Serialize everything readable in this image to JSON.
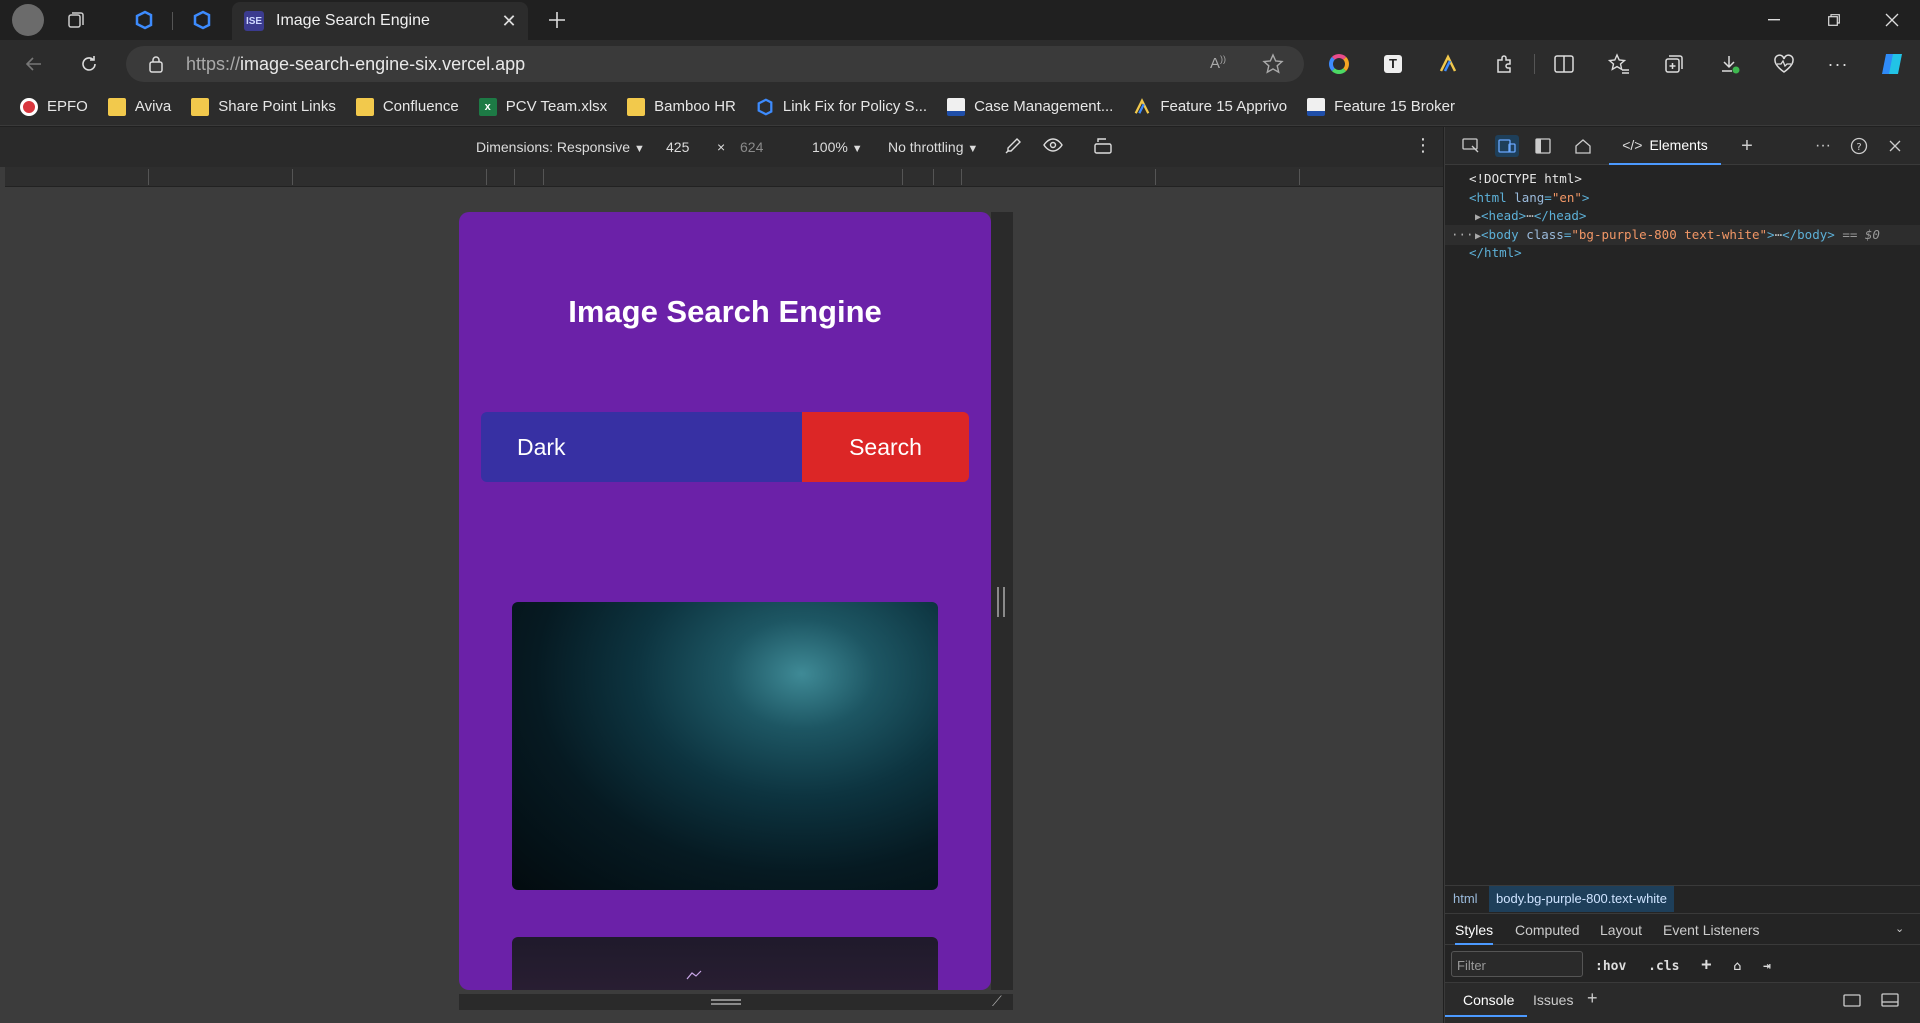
{
  "browser": {
    "tab": {
      "favicon_text": "ISE",
      "title": "Image Search Engine"
    },
    "url": {
      "scheme": "https://",
      "host": "image-search-engine-six.vercel.app"
    },
    "bookmarks": [
      {
        "label": "EPFO",
        "icon": "epfo-icon"
      },
      {
        "label": "Aviva",
        "icon": "folder-icon"
      },
      {
        "label": "Share Point Links",
        "icon": "folder-icon"
      },
      {
        "label": "Confluence",
        "icon": "folder-icon"
      },
      {
        "label": "PCV Team.xlsx",
        "icon": "excel-icon"
      },
      {
        "label": "Bamboo HR",
        "icon": "folder-icon"
      },
      {
        "label": "Link Fix for Policy S...",
        "icon": "azure-devops-icon"
      },
      {
        "label": "Case Management...",
        "icon": "aviva-icon"
      },
      {
        "label": "Feature 15 Apprivo",
        "icon": "apprivo-icon"
      },
      {
        "label": "Feature 15 Broker",
        "icon": "aviva-icon"
      }
    ]
  },
  "device_toolbar": {
    "dimensions_label": "Dimensions: Responsive",
    "width": "425",
    "times": "×",
    "height": "624",
    "zoom": "100%",
    "throttling": "No throttling"
  },
  "page": {
    "title": "Image Search Engine",
    "search_value": "Dark",
    "search_button": "Search"
  },
  "devtools": {
    "active_tab": "Elements",
    "dom": {
      "doctype": "<!DOCTYPE html>",
      "html_open_tag": "<html",
      "html_attr": "lang",
      "html_attr_val": "\"en\"",
      "html_open_end": ">",
      "head_open": "<head>",
      "head_close": "</head>",
      "body_open": "<body",
      "body_attr": "class",
      "body_attr_val": "\"bg-purple-800 text-white\"",
      "body_open_end": ">",
      "body_close": "</body>",
      "selected_marker": "== $0",
      "html_close": "</html>"
    },
    "breadcrumbs": [
      "html",
      "body.bg-purple-800.text-white"
    ],
    "styles_tabs": [
      "Styles",
      "Computed",
      "Layout",
      "Event Listeners"
    ],
    "filter_placeholder": "Filter",
    "filter_tools": [
      ":hov",
      ".cls"
    ],
    "drawer_tabs": [
      "Console",
      "Issues"
    ]
  }
}
